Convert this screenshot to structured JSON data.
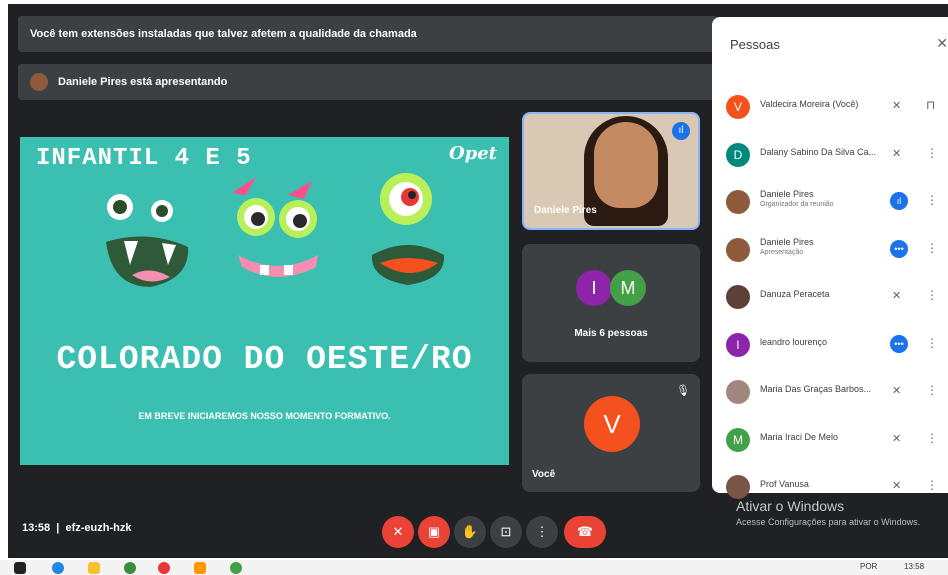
{
  "banners": {
    "extensions": "Você tem extensões instaladas que talvez afetem a qualidade da chamada",
    "presenting": "Daniele Pires está apresentando"
  },
  "slide": {
    "top_text": "INFANTIL 4 E 5",
    "logo_text": "Opet",
    "title": "COLORADO DO OESTE/RO",
    "subtitle": "EM BREVE INICIAREMOS NOSSO MOMENTO FORMATIVO."
  },
  "tiles": {
    "daniele_name": "Daniele Pires",
    "more_avatars": [
      "I",
      "M"
    ],
    "more_label": "Mais 6 pessoas",
    "you_label": "Você",
    "you_initial": "V"
  },
  "meeting": {
    "time": "13:58",
    "code": "efz-euzh-hzk"
  },
  "people_panel": {
    "title": "Pessoas",
    "participants": [
      {
        "name": "Valdecira Moreira (Você)",
        "initial": "V",
        "color": "#f4511e",
        "role": "",
        "mic": "muted"
      },
      {
        "name": "Dalany Sabino Da Silva Ca...",
        "initial": "D",
        "color": "#00897b",
        "role": "",
        "mic": "muted"
      },
      {
        "name": "Daniele Pires",
        "initial": "",
        "color": "#8d5a3c",
        "role": "Organizador da reunião",
        "mic": "active"
      },
      {
        "name": "Daniele Pires",
        "initial": "",
        "color": "#8d5a3c",
        "role": "Apresentação",
        "mic": "dots"
      },
      {
        "name": "Danuza Peraceta",
        "initial": "",
        "color": "#5d4037",
        "role": "",
        "mic": "muted"
      },
      {
        "name": "leandro lourenço",
        "initial": "l",
        "color": "#8e24aa",
        "role": "",
        "mic": "dots"
      },
      {
        "name": "Maria Das Graças Barbos...",
        "initial": "",
        "color": "#a1887f",
        "role": "",
        "mic": "muted"
      },
      {
        "name": "Maria Iraci De Melo",
        "initial": "M",
        "color": "#43a047",
        "role": "",
        "mic": "muted"
      },
      {
        "name": "Prof Vanusa",
        "initial": "",
        "color": "#795548",
        "role": "",
        "mic": "muted"
      }
    ]
  },
  "watermark": {
    "title": "Ativar o Windows",
    "subtitle": "Acesse Configurações para ativar o Windows."
  },
  "taskbar": {
    "lang": "POR",
    "clock": "13:58"
  }
}
